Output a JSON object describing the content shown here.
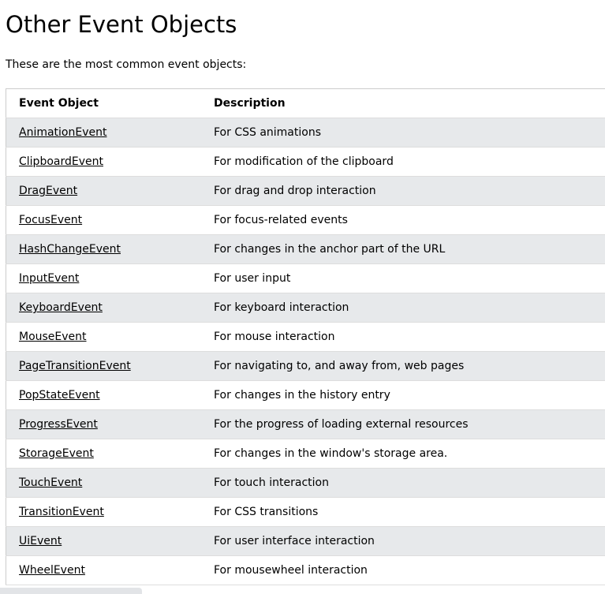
{
  "title": "Other Event Objects",
  "intro": "These are the most common event objects:",
  "table": {
    "headers": [
      "Event Object",
      "Description"
    ],
    "rows": [
      {
        "name": "AnimationEvent",
        "desc": "For CSS animations"
      },
      {
        "name": "ClipboardEvent",
        "desc": "For modification of the clipboard"
      },
      {
        "name": "DragEvent",
        "desc": "For drag and drop interaction"
      },
      {
        "name": "FocusEvent",
        "desc": "For focus-related events"
      },
      {
        "name": "HashChangeEvent",
        "desc": "For changes in the anchor part of the URL"
      },
      {
        "name": "InputEvent",
        "desc": "For user input"
      },
      {
        "name": "KeyboardEvent",
        "desc": "For keyboard interaction"
      },
      {
        "name": "MouseEvent",
        "desc": "For mouse interaction"
      },
      {
        "name": "PageTransitionEvent",
        "desc": "For navigating to, and away from, web pages"
      },
      {
        "name": "PopStateEvent",
        "desc": "For changes in the history entry"
      },
      {
        "name": "ProgressEvent",
        "desc": "For the progress of loading external resources"
      },
      {
        "name": "StorageEvent",
        "desc": "For changes in the window's storage area."
      },
      {
        "name": "TouchEvent",
        "desc": "For touch interaction"
      },
      {
        "name": "TransitionEvent",
        "desc": "For CSS transitions"
      },
      {
        "name": "UiEvent",
        "desc": "For user interface interaction"
      },
      {
        "name": "WheelEvent",
        "desc": "For mousewheel interaction"
      }
    ]
  }
}
